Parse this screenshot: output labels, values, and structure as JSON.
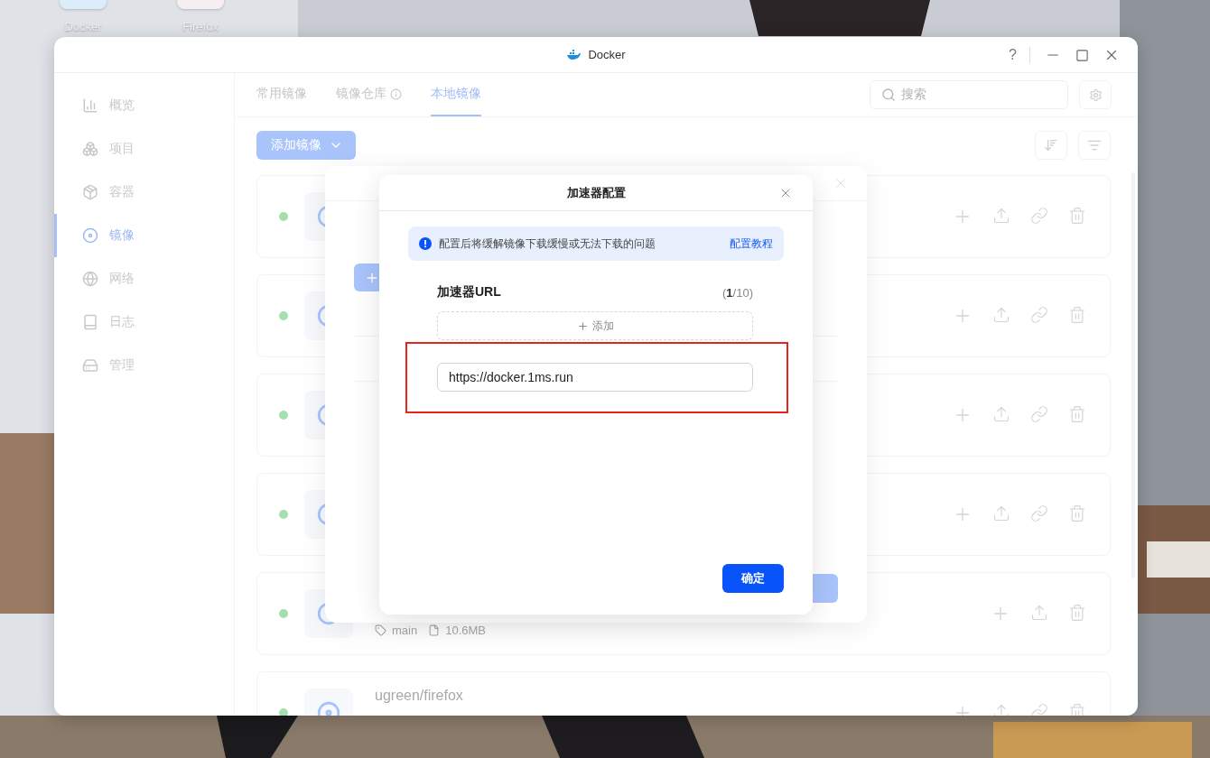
{
  "desktop": {
    "icons": [
      {
        "label": "Docker",
        "kind": "docker"
      },
      {
        "label": "Firefox",
        "kind": "firefox"
      }
    ]
  },
  "window": {
    "title": "Docker",
    "help": "?"
  },
  "sidebar": {
    "items": [
      {
        "label": "概览",
        "kind": "chart",
        "selected": false
      },
      {
        "label": "项目",
        "kind": "cubes",
        "selected": false
      },
      {
        "label": "容器",
        "kind": "box",
        "selected": false
      },
      {
        "label": "镜像",
        "kind": "disc",
        "selected": true
      },
      {
        "label": "网络",
        "kind": "globe",
        "selected": false
      },
      {
        "label": "日志",
        "kind": "book",
        "selected": false
      },
      {
        "label": "管理",
        "kind": "drive",
        "selected": false
      }
    ]
  },
  "tabs": [
    {
      "label": "常用镜像",
      "selected": false,
      "info": false
    },
    {
      "label": "镜像仓库",
      "selected": false,
      "info": true
    },
    {
      "label": "本地镜像",
      "selected": true,
      "info": false
    }
  ],
  "search": {
    "placeholder": "搜索"
  },
  "add_button": {
    "label": "添加镜像"
  },
  "images": [
    {
      "link": true
    },
    {
      "link": true
    },
    {
      "link": true
    },
    {
      "link": true
    },
    {
      "tags": [
        "main",
        "10.6MB"
      ],
      "link": false
    },
    {
      "name": "ugreen/firefox",
      "link": true
    }
  ],
  "dialog": {
    "title": "加速器配置",
    "notice": "配置后将缓解镜像下载缓慢或无法下载的问题",
    "notice_link": "配置教程",
    "field_label": "加速器URL",
    "count": "(**1**/10)",
    "add_label": "添加",
    "urls": [
      "https://docker.1ms.run"
    ],
    "confirm": "确定"
  }
}
